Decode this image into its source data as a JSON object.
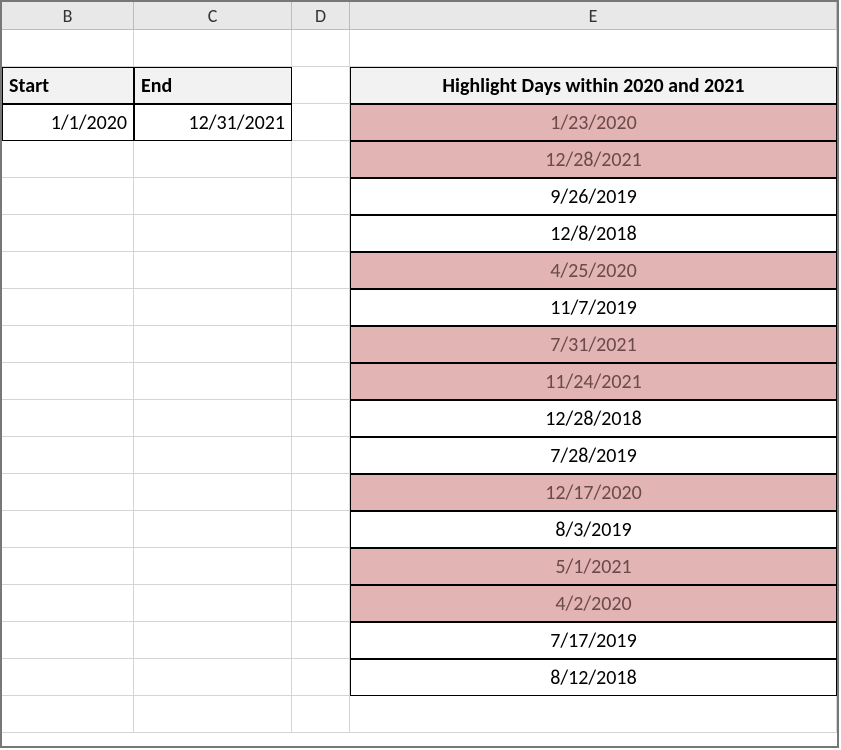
{
  "columns": {
    "B": "B",
    "C": "C",
    "D": "D",
    "E": "E"
  },
  "range": {
    "start_label": "Start",
    "end_label": "End",
    "start_value": "1/1/2020",
    "end_value": "12/31/2021"
  },
  "highlight_header": "Highlight Days within 2020 and 2021",
  "dates": [
    {
      "value": "1/23/2020",
      "highlighted": true
    },
    {
      "value": "12/28/2021",
      "highlighted": true
    },
    {
      "value": "9/26/2019",
      "highlighted": false
    },
    {
      "value": "12/8/2018",
      "highlighted": false
    },
    {
      "value": "4/25/2020",
      "highlighted": true
    },
    {
      "value": "11/7/2019",
      "highlighted": false
    },
    {
      "value": "7/31/2021",
      "highlighted": true
    },
    {
      "value": "11/24/2021",
      "highlighted": true
    },
    {
      "value": "12/28/2018",
      "highlighted": false
    },
    {
      "value": "7/28/2019",
      "highlighted": false
    },
    {
      "value": "12/17/2020",
      "highlighted": true
    },
    {
      "value": "8/3/2019",
      "highlighted": false
    },
    {
      "value": "5/1/2021",
      "highlighted": true
    },
    {
      "value": "4/2/2020",
      "highlighted": true
    },
    {
      "value": "7/17/2019",
      "highlighted": false
    },
    {
      "value": "8/12/2018",
      "highlighted": false
    }
  ]
}
